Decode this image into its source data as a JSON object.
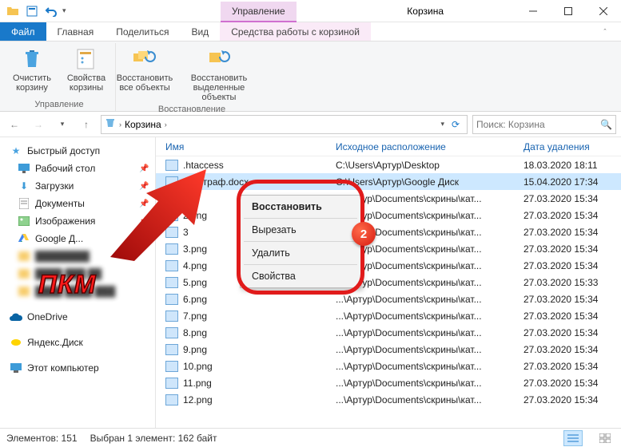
{
  "window": {
    "title": "Корзина",
    "title_manage": "Управление"
  },
  "tabs": {
    "file": "Файл",
    "home": "Главная",
    "share": "Поделиться",
    "view": "Вид",
    "tool": "Средства работы с корзиной"
  },
  "ribbon": {
    "empty": "Очистить корзину",
    "props": "Свойства корзины",
    "restore_all": "Восстановить все объекты",
    "restore_sel": "Восстановить выделенные объекты",
    "group_manage": "Управление",
    "group_restore": "Восстановление"
  },
  "breadcrumb": {
    "root": "Корзина",
    "sep": "›"
  },
  "search": {
    "placeholder": "Поиск: Корзина"
  },
  "sidebar": {
    "quick": "Быстрый доступ",
    "items": [
      {
        "label": "Рабочий стол",
        "pin": true
      },
      {
        "label": "Загрузки",
        "pin": true
      },
      {
        "label": "Документы",
        "pin": true
      },
      {
        "label": "Изображения",
        "pin": true
      },
      {
        "label": "Google Д...",
        "pin": true
      }
    ],
    "onedrive": "OneDrive",
    "yadisk": "Яндекс.Диск",
    "thispc": "Этот компьютер"
  },
  "columns": {
    "name": "Имя",
    "loc": "Исходное расположение",
    "date": "Дата удаления"
  },
  "rows": [
    {
      "name": ".htaccess",
      "loc": "C:\\Users\\Артур\\Desktop",
      "date": "18.03.2020 18:11",
      "sel": false
    },
    {
      "name": "~$Штраф.docx",
      "loc": "C:\\Users\\Артур\\Google Диск",
      "date": "15.04.2020 17:34",
      "sel": true
    },
    {
      "name": "2",
      "loc": "...\\Артур\\Documents\\скрины\\кат...",
      "date": "27.03.2020 15:34",
      "sel": false
    },
    {
      "name": "2.png",
      "loc": "...\\Артур\\Documents\\скрины\\кат...",
      "date": "27.03.2020 15:34",
      "sel": false
    },
    {
      "name": "3",
      "loc": "...\\Артур\\Documents\\скрины\\кат...",
      "date": "27.03.2020 15:34",
      "sel": false
    },
    {
      "name": "3.png",
      "loc": "...\\Артур\\Documents\\скрины\\кат...",
      "date": "27.03.2020 15:34",
      "sel": false
    },
    {
      "name": "4.png",
      "loc": "...\\Артур\\Documents\\скрины\\кат...",
      "date": "27.03.2020 15:34",
      "sel": false
    },
    {
      "name": "5.png",
      "loc": "...\\Артур\\Documents\\скрины\\кат...",
      "date": "27.03.2020 15:33",
      "sel": false
    },
    {
      "name": "6.png",
      "loc": "...\\Артур\\Documents\\скрины\\кат...",
      "date": "27.03.2020 15:34",
      "sel": false
    },
    {
      "name": "7.png",
      "loc": "...\\Артур\\Documents\\скрины\\кат...",
      "date": "27.03.2020 15:34",
      "sel": false
    },
    {
      "name": "8.png",
      "loc": "...\\Артур\\Documents\\скрины\\кат...",
      "date": "27.03.2020 15:34",
      "sel": false
    },
    {
      "name": "9.png",
      "loc": "...\\Артур\\Documents\\скрины\\кат...",
      "date": "27.03.2020 15:34",
      "sel": false
    },
    {
      "name": "10.png",
      "loc": "...\\Артур\\Documents\\скрины\\кат...",
      "date": "27.03.2020 15:34",
      "sel": false
    },
    {
      "name": "11.png",
      "loc": "...\\Артур\\Documents\\скрины\\кат...",
      "date": "27.03.2020 15:34",
      "sel": false
    },
    {
      "name": "12.png",
      "loc": "...\\Артур\\Documents\\скрины\\кат...",
      "date": "27.03.2020 15:34",
      "sel": false
    }
  ],
  "context": {
    "restore": "Восстановить",
    "cut": "Вырезать",
    "delete": "Удалить",
    "props": "Свойства"
  },
  "callouts": {
    "pkm": "ПКМ",
    "two": "2"
  },
  "status": {
    "count": "Элементов: 151",
    "sel": "Выбран 1 элемент: 162 байт"
  }
}
